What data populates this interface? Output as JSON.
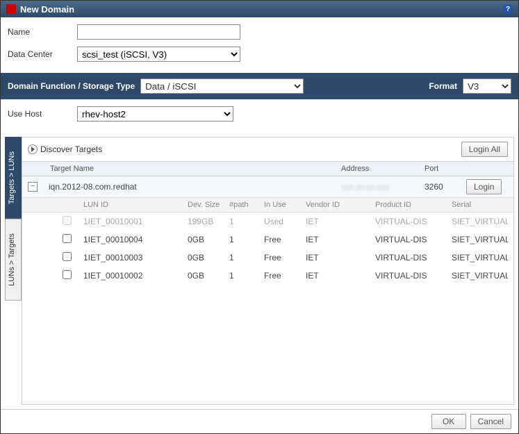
{
  "title": "New Domain",
  "form": {
    "name_label": "Name",
    "name_value": "",
    "data_center_label": "Data Center",
    "data_center_value": "scsi_test (iSCSI, V3)"
  },
  "darkbar": {
    "domain_function_label": "Domain Function / Storage Type",
    "domain_function_value": "Data / iSCSI",
    "format_label": "Format",
    "format_value": "V3"
  },
  "use_host": {
    "label": "Use Host",
    "value": "rhev-host2"
  },
  "side_tabs": {
    "targets_to_luns": "Targets > LUNs",
    "luns_to_targets": "LUNs > Targets"
  },
  "discover": {
    "label": "Discover Targets",
    "login_all": "Login All"
  },
  "target_header": {
    "name": "Target Name",
    "address": "Address",
    "port": "Port"
  },
  "target": {
    "name": "iqn.2012-08.com.redhat",
    "address": "xxx.xx.xx.xxx",
    "port": "3260",
    "login_btn": "Login"
  },
  "lun_header": {
    "lun_id": "LUN ID",
    "dev_size": "Dev. Size",
    "path": "#path",
    "in_use": "In Use",
    "vendor_id": "Vendor ID",
    "product_id": "Product ID",
    "serial": "Serial"
  },
  "luns": [
    {
      "id": "1IET_00010001",
      "size": "199GB",
      "path": "1",
      "use": "Used",
      "vendor": "IET",
      "product": "VIRTUAL-DIS",
      "serial": "SIET_VIRTUAL-",
      "disabled": true
    },
    {
      "id": "1IET_00010004",
      "size": "0GB",
      "path": "1",
      "use": "Free",
      "vendor": "IET",
      "product": "VIRTUAL-DIS",
      "serial": "SIET_VIRTUAL-",
      "disabled": false
    },
    {
      "id": "1IET_00010003",
      "size": "0GB",
      "path": "1",
      "use": "Free",
      "vendor": "IET",
      "product": "VIRTUAL-DIS",
      "serial": "SIET_VIRTUAL-",
      "disabled": false
    },
    {
      "id": "1IET_00010002",
      "size": "0GB",
      "path": "1",
      "use": "Free",
      "vendor": "IET",
      "product": "VIRTUAL-DIS",
      "serial": "SIET_VIRTUAL-",
      "disabled": false
    }
  ],
  "footer": {
    "ok": "OK",
    "cancel": "Cancel"
  }
}
